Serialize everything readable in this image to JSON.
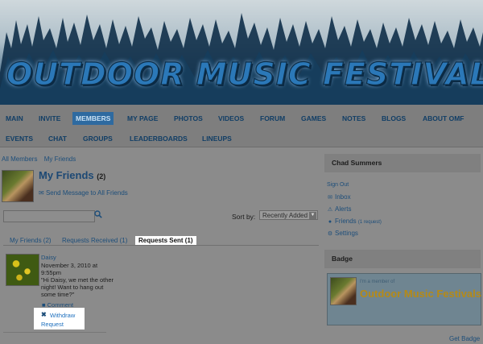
{
  "banner": {
    "title": "OUTDOOR MUSIC FESTIVALS"
  },
  "nav": {
    "row1": [
      "MAIN",
      "INVITE",
      "MEMBERS",
      "MY PAGE",
      "PHOTOS",
      "VIDEOS",
      "FORUM",
      "GAMES",
      "NOTES",
      "BLOGS",
      "ABOUT OMF"
    ],
    "row2": [
      "EVENTS",
      "CHAT",
      "GROUPS",
      "LEADERBOARDS",
      "LINEUPS"
    ],
    "active": "MEMBERS"
  },
  "breadcrumbs": [
    "All Members",
    "My Friends"
  ],
  "page": {
    "title": "My Friends",
    "count": "(2)",
    "send_message": "Send Message to All Friends"
  },
  "search": {
    "placeholder": ""
  },
  "sort": {
    "label": "Sort by:",
    "value": "Recently Added"
  },
  "tabs": [
    "My Friends (2)",
    "Requests Received (1)",
    "Requests Sent (1)"
  ],
  "request": {
    "name": "Daisy",
    "date": "November 3, 2010 at 9:55pm",
    "message": "\"Hi Daisy, we met the other night! Want to hang out some time?\"",
    "comment": "Comment",
    "withdraw_1": "Withdraw",
    "withdraw_2": "Request"
  },
  "sidebar": {
    "user_name": "Chad Summers",
    "sign_out": "Sign Out",
    "inbox": "Inbox",
    "alerts": "Alerts",
    "friends": "Friends",
    "friends_sub": "(1 request)",
    "settings": "Settings",
    "badge_heading": "Badge",
    "badge_small": "I'm a member of",
    "badge_title": "Outdoor Music Festivals",
    "get_badge": "Get Badge"
  },
  "icons": {
    "search": "search-icon",
    "envelope": "envelope-icon",
    "alert": "alert-icon",
    "person": "person-icon",
    "gear": "gear-icon",
    "comment": "comment-icon",
    "close": "close-icon"
  },
  "colors": {
    "link": "#1d4e7a",
    "active_nav": "#2e6aa0",
    "badge_gold": "#b58a17"
  }
}
